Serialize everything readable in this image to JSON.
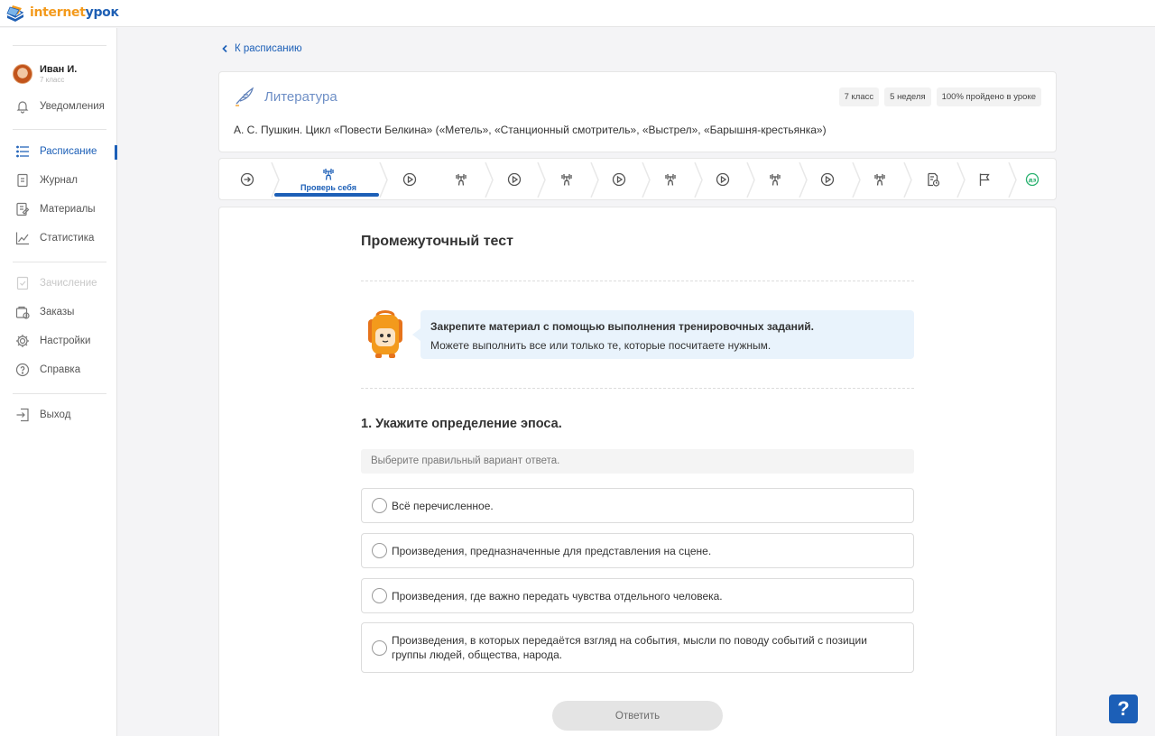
{
  "brand": {
    "logo_part1": "internet",
    "logo_part2": "урок",
    "color_orange": "#f39a1c",
    "color_blue": "#1e5fb4"
  },
  "user": {
    "name": "Иван И.",
    "class": "7 класс"
  },
  "sidebar": {
    "items": [
      {
        "label": "Уведомления",
        "icon": "bell-icon"
      },
      {
        "label": "Расписание",
        "icon": "schedule-list-icon",
        "active": true
      },
      {
        "label": "Журнал",
        "icon": "journal-icon"
      },
      {
        "label": "Материалы",
        "icon": "materials-icon"
      },
      {
        "label": "Статистика",
        "icon": "chart-icon"
      },
      {
        "label": "Зачисление",
        "icon": "enrollment-icon",
        "disabled": true
      },
      {
        "label": "Заказы",
        "icon": "orders-icon"
      },
      {
        "label": "Настройки",
        "icon": "gear-icon"
      },
      {
        "label": "Справка",
        "icon": "help-circle-icon"
      },
      {
        "label": "Выход",
        "icon": "logout-icon"
      }
    ]
  },
  "back_link": "К расписанию",
  "lesson": {
    "subject": "Литература",
    "badges": [
      "7 класс",
      "5 неделя",
      "100% пройдено в уроке"
    ],
    "title": "А. С. Пушкин. Цикл «Повести Белкина» («Метель», «Станционный смотритель», «Выстрел», «Барышня-крестьянка»)"
  },
  "steps": {
    "items": [
      {
        "icon": "arrow-right-circle-icon"
      },
      {
        "icon": "dumbbell-icon",
        "label": "Проверь себя",
        "active": true
      },
      {
        "icon": "play-circle-icon"
      },
      {
        "icon": "dumbbell-icon"
      },
      {
        "icon": "play-circle-icon"
      },
      {
        "icon": "dumbbell-icon"
      },
      {
        "icon": "play-circle-icon"
      },
      {
        "icon": "dumbbell-icon"
      },
      {
        "icon": "play-circle-icon"
      },
      {
        "icon": "dumbbell-icon"
      },
      {
        "icon": "play-circle-icon"
      },
      {
        "icon": "dumbbell-icon"
      },
      {
        "icon": "document-clock-icon"
      },
      {
        "icon": "flag-icon"
      },
      {
        "icon": "homework-icon",
        "label": "дз"
      }
    ]
  },
  "test": {
    "title": "Промежуточный тест",
    "hint_line1": "Закрепите материал с помощью выполнения тренировочных заданий.",
    "hint_line2": "Можете выполнить все или только те, которые посчитаете нужным.",
    "question": "1. Укажите определение эпоса.",
    "instruction": "Выберите правильный вариант ответа.",
    "options": [
      "Всё перечисленное.",
      "Произведения, предназначенные для представления на сцене.",
      "Произведения, где важно передать чувства отдельного человека.",
      "Произведения, в которых передаётся взгляд на события, мысли по поводу событий с позиции группы людей, общества, народа."
    ],
    "submit_label": "Ответить"
  },
  "help_button": "?"
}
